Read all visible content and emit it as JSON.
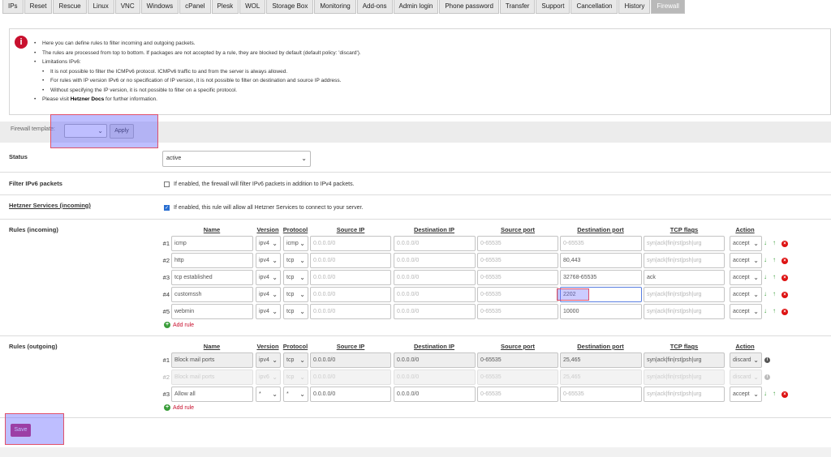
{
  "tabs": [
    "IPs",
    "Reset",
    "Rescue",
    "Linux",
    "VNC",
    "Windows",
    "cPanel",
    "Plesk",
    "WOL",
    "Storage Box",
    "Monitoring",
    "Add-ons",
    "Admin login",
    "Phone password",
    "Transfer",
    "Support",
    "Cancellation",
    "History",
    "Firewall"
  ],
  "active_tab": "Firewall",
  "info": {
    "lines": [
      "Here you can define rules to filter incoming and outgoing packets.",
      "The rules are processed from top to bottom. If packages are not accepted by a rule, they are blocked by default (default policy: 'discard').",
      "Limitations IPv6:"
    ],
    "sub_lines": [
      "It is not possible to filter the ICMPv6 protocol. ICMPv6 traffic to and from the server is always allowed.",
      "For rules with IP version IPv6 or no specification of IP version, it is not possible to filter on destination and source IP address.",
      "Without specifying the IP version, it is not possible to filter on a specific protocol."
    ],
    "docs_prefix": "Please visit ",
    "docs_link": "Hetzner Docs",
    "docs_suffix": " for further information."
  },
  "template": {
    "label": "Firewall template:",
    "value": "",
    "apply": "Apply"
  },
  "status": {
    "label": "Status",
    "value": "active"
  },
  "ipv6": {
    "label": "Filter IPv6 packets",
    "text": "If enabled, the firewall will filter IPv6 packets in addition to IPv4 packets.",
    "checked": false
  },
  "hetzner": {
    "label": "Hetzner Services (incoming)",
    "text": "If enabled, this rule will allow all Hetzner Services to connect to your server.",
    "checked": true
  },
  "columns": [
    "Name",
    "Version",
    "Protocol",
    "Source IP",
    "Destination IP",
    "Source port",
    "Destination port",
    "TCP flags",
    "Action"
  ],
  "placeholders": {
    "ip": "0.0.0.0/0",
    "port": "0-65535",
    "flags": "syn|ack|fin|rst|psh|urg"
  },
  "incoming": {
    "label": "Rules (incoming)",
    "rules": [
      {
        "num": "#1",
        "name": "icmp",
        "version": "ipv4",
        "protocol": "icmp",
        "src_ip": "",
        "dst_ip": "",
        "src_port": "",
        "dst_port": "",
        "flags": "",
        "action": "accept"
      },
      {
        "num": "#2",
        "name": "http",
        "version": "ipv4",
        "protocol": "tcp",
        "src_ip": "",
        "dst_ip": "",
        "src_port": "",
        "dst_port": "80,443",
        "flags": "",
        "action": "accept"
      },
      {
        "num": "#3",
        "name": "tcp established",
        "version": "ipv4",
        "protocol": "tcp",
        "src_ip": "",
        "dst_ip": "",
        "src_port": "",
        "dst_port": "32768-65535",
        "flags": "ack",
        "action": "accept"
      },
      {
        "num": "#4",
        "name": "customssh",
        "version": "ipv4",
        "protocol": "tcp",
        "src_ip": "",
        "dst_ip": "",
        "src_port": "",
        "dst_port": "2202",
        "flags": "",
        "action": "accept"
      },
      {
        "num": "#5",
        "name": "webmin",
        "version": "ipv4",
        "protocol": "tcp",
        "src_ip": "",
        "dst_ip": "",
        "src_port": "",
        "dst_port": "10000",
        "flags": "",
        "action": "accept"
      }
    ],
    "add": "Add rule"
  },
  "outgoing": {
    "label": "Rules (outgoing)",
    "rules": [
      {
        "num": "#1",
        "name": "Block mail ports",
        "version": "ipv4",
        "protocol": "tcp",
        "src_ip": "0.0.0.0/0",
        "dst_ip": "0.0.0.0/0",
        "src_port": "0-65535",
        "dst_port": "25,465",
        "flags": "syn|ack|fin|rst|psh|urg",
        "action": "discard",
        "readonly": true
      },
      {
        "num": "#2",
        "name": "Block mail ports",
        "version": "ipv6",
        "protocol": "tcp",
        "src_ip": "",
        "dst_ip": "",
        "src_port": "",
        "dst_port": "25,465",
        "flags": "",
        "action": "discard",
        "disabled": true
      },
      {
        "num": "#3",
        "name": "Allow all",
        "version": "*",
        "protocol": "*",
        "src_ip": "0.0.0.0/0",
        "dst_ip": "0.0.0.0/0",
        "src_port": "",
        "dst_port": "",
        "flags": "",
        "action": "accept"
      }
    ],
    "add": "Add rule"
  },
  "save": "Save"
}
